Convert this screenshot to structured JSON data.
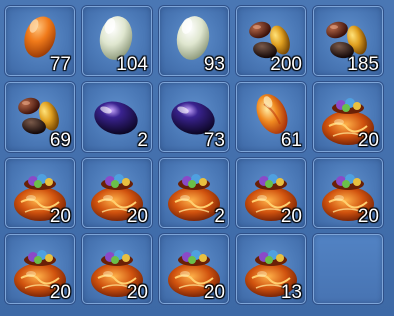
{
  "inventory": {
    "slots": [
      {
        "item": "orange-egg-icon",
        "qty": "77"
      },
      {
        "item": "white-egg-icon",
        "qty": "104"
      },
      {
        "item": "white-egg-icon",
        "qty": "93"
      },
      {
        "item": "mixed-beans-icon",
        "qty": "200"
      },
      {
        "item": "mixed-beans-icon",
        "qty": "185"
      },
      {
        "item": "mixed-beans-icon",
        "qty": "69"
      },
      {
        "item": "dark-purple-gem-icon",
        "qty": "2"
      },
      {
        "item": "dark-purple-gem-icon",
        "qty": "73"
      },
      {
        "item": "orange-gem-icon",
        "qty": "61"
      },
      {
        "item": "treasure-pouch-icon",
        "qty": "20"
      },
      {
        "item": "treasure-pouch-icon",
        "qty": "20"
      },
      {
        "item": "treasure-pouch-icon",
        "qty": "20"
      },
      {
        "item": "treasure-pouch-icon",
        "qty": "2"
      },
      {
        "item": "treasure-pouch-icon",
        "qty": "20"
      },
      {
        "item": "treasure-pouch-icon",
        "qty": "20"
      },
      {
        "item": "treasure-pouch-icon",
        "qty": "20"
      },
      {
        "item": "treasure-pouch-icon",
        "qty": "20"
      },
      {
        "item": "treasure-pouch-icon",
        "qty": "20"
      },
      {
        "item": "treasure-pouch-icon",
        "qty": "13"
      },
      {
        "item": "empty-slot",
        "qty": ""
      }
    ]
  }
}
